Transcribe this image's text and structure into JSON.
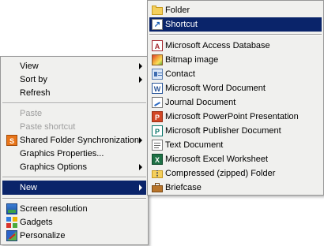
{
  "context_menu": {
    "items": [
      {
        "label": "View",
        "submenu": true
      },
      {
        "label": "Sort by",
        "submenu": true
      },
      {
        "label": "Refresh"
      },
      {
        "label": "Paste",
        "disabled": true
      },
      {
        "label": "Paste shortcut",
        "disabled": true
      },
      {
        "label": "Shared Folder Synchronization",
        "submenu": true,
        "icon": "sync-icon"
      },
      {
        "label": "Graphics Properties..."
      },
      {
        "label": "Graphics Options",
        "submenu": true
      },
      {
        "label": "New",
        "submenu": true,
        "highlighted": true
      },
      {
        "label": "Screen resolution",
        "icon": "screen-resolution-icon"
      },
      {
        "label": "Gadgets",
        "icon": "gadgets-icon"
      },
      {
        "label": "Personalize",
        "icon": "personalize-icon"
      }
    ]
  },
  "new_submenu": {
    "items": [
      {
        "label": "Folder",
        "icon": "folder-icon"
      },
      {
        "label": "Shortcut",
        "icon": "shortcut-icon",
        "highlighted": true
      },
      {
        "label": "Microsoft Access Database",
        "icon": "access-icon",
        "glyph": "A"
      },
      {
        "label": "Bitmap image",
        "icon": "bitmap-icon"
      },
      {
        "label": "Contact",
        "icon": "contact-icon"
      },
      {
        "label": "Microsoft Word Document",
        "icon": "word-icon",
        "glyph": "W"
      },
      {
        "label": "Journal Document",
        "icon": "journal-icon"
      },
      {
        "label": "Microsoft PowerPoint Presentation",
        "icon": "powerpoint-icon",
        "glyph": "P"
      },
      {
        "label": "Microsoft Publisher Document",
        "icon": "publisher-icon",
        "glyph": "P"
      },
      {
        "label": "Text Document",
        "icon": "text-document-icon"
      },
      {
        "label": "Microsoft Excel Worksheet",
        "icon": "excel-icon",
        "glyph": "X"
      },
      {
        "label": "Compressed (zipped) Folder",
        "icon": "zip-folder-icon"
      },
      {
        "label": "Briefcase",
        "icon": "briefcase-icon"
      }
    ]
  },
  "colors": {
    "highlight": "#0a246a",
    "menu_background": "#f0f0ee",
    "disabled_text": "#9d9d9d"
  }
}
